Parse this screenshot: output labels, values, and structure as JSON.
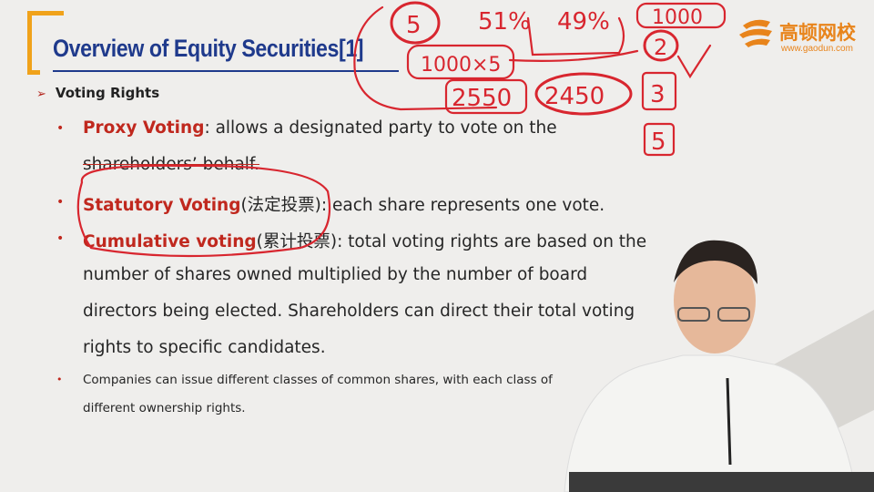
{
  "slide": {
    "title": "Overview of Equity Securities[1]",
    "section": "Voting Rights",
    "items": [
      {
        "term": "Proxy Voting",
        "text": ": allows a designated party to vote on the",
        "continuation": "shareholders’ behalf."
      },
      {
        "term": "Statutory Voting",
        "cn": "(法定投票)",
        "text": ": each share represents one vote."
      },
      {
        "term": "Cumulative voting",
        "cn": "(累计投票)",
        "text": ": total voting rights are based on the",
        "continuation": [
          "number of shares owned multiplied by the number of board",
          "directors being elected. Shareholders can direct their total voting",
          "rights to specific candidates."
        ]
      },
      {
        "text": "Companies can issue different classes of common shares, with each class of",
        "continuation": "different ownership rights."
      }
    ]
  },
  "logo": {
    "name_cn": "高顿网校",
    "url": "www.gaodun.com"
  },
  "annotations": {
    "n1": "5",
    "p1": "51%",
    "p2": "49%",
    "n2": "1000",
    "expr": "1000×5",
    "n3": "2",
    "n4": "2550",
    "n5": "2450",
    "n6": "3",
    "n7": "5"
  },
  "colors": {
    "title": "#1f3a8c",
    "accent": "#f0a21a",
    "term": "#c0281e",
    "ink": "#d8262f"
  }
}
